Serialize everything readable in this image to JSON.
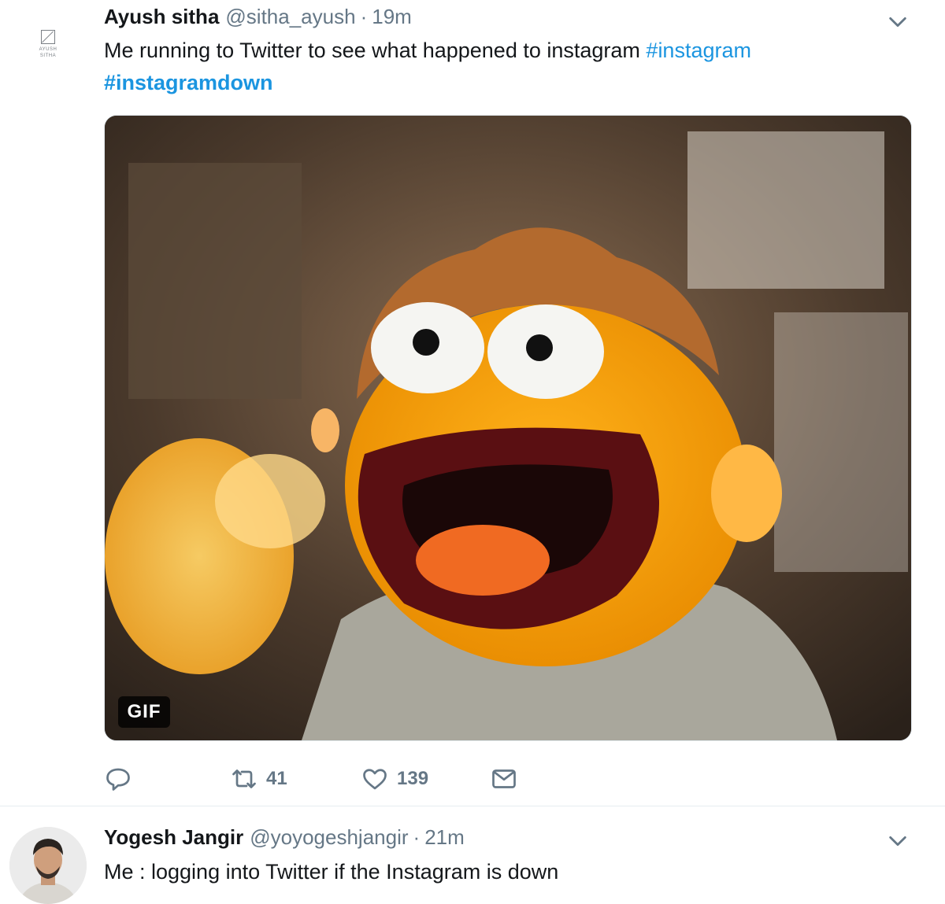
{
  "tweets": [
    {
      "avatar_text": [
        "A S",
        "AYUSH",
        "SITHA"
      ],
      "name": "Ayush sitha",
      "handle": "@sitha_ayush",
      "separator": "·",
      "time": "19m",
      "text_main": "Me running to Twitter to see what happened to instagram ",
      "hashtag1": "#instagram",
      "hashtag2": "#instagramdown",
      "media": {
        "badge": "GIF"
      },
      "actions": {
        "retweets": "41",
        "likes": "139"
      }
    },
    {
      "name": "Yogesh Jangir",
      "handle": "@yoyogeshjangir",
      "separator": "·",
      "time": "21m",
      "text_main": "Me : logging into Twitter if the Instagram is down"
    }
  ],
  "colors": {
    "link": "#1b95e0",
    "secondary": "#657786",
    "text": "#14171a",
    "divider": "#e6ecf0"
  },
  "icons": [
    "chevron-down-icon",
    "reply-icon",
    "retweet-icon",
    "like-icon",
    "message-icon"
  ]
}
